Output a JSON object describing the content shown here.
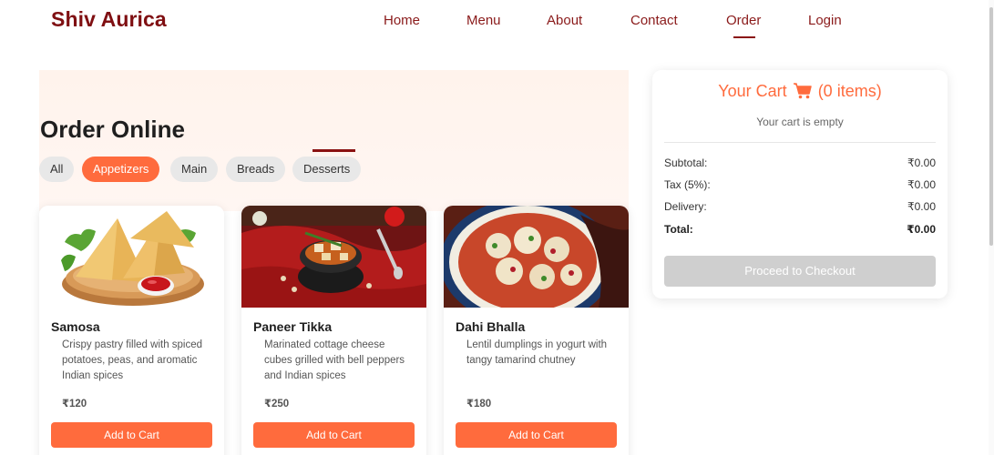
{
  "header": {
    "brand": "Shiv Aurica",
    "nav": [
      "Home",
      "Menu",
      "About",
      "Contact",
      "Order",
      "Login"
    ],
    "active_nav": "Order"
  },
  "main": {
    "title": "Order Online",
    "filters": [
      "All",
      "Appetizers",
      "Main",
      "Breads",
      "Desserts"
    ],
    "active_filter": "Appetizers",
    "products": [
      {
        "name": "Samosa",
        "description": "Crispy pastry filled with spiced potatoes, peas, and aromatic Indian spices",
        "price": "₹120",
        "button": "Add to Cart",
        "image": "samosa-image"
      },
      {
        "name": "Paneer Tikka",
        "description": "Marinated cottage cheese cubes grilled with bell peppers and Indian spices",
        "price": "₹250",
        "button": "Add to Cart",
        "image": "paneer-tikka-image"
      },
      {
        "name": "Dahi Bhalla",
        "description": "Lentil dumplings in yogurt with tangy tamarind chutney",
        "price": "₹180",
        "button": "Add to Cart",
        "image": "dahi-bhalla-image"
      }
    ]
  },
  "cart": {
    "title": "Your Cart",
    "count_text": "(0 items)",
    "empty_text": "Your cart is empty",
    "subtotal_label": "Subtotal:",
    "subtotal": "₹0.00",
    "tax_label": "Tax (5%):",
    "tax": "₹0.00",
    "delivery_label": "Delivery:",
    "delivery": "₹0.00",
    "total_label": "Total:",
    "total": "₹0.00",
    "checkout_label": "Proceed to Checkout"
  },
  "colors": {
    "brand": "#7f0f12",
    "accent": "#ff6b3d",
    "chip": "#e8e8e8",
    "disabled": "#cfcfcf"
  }
}
